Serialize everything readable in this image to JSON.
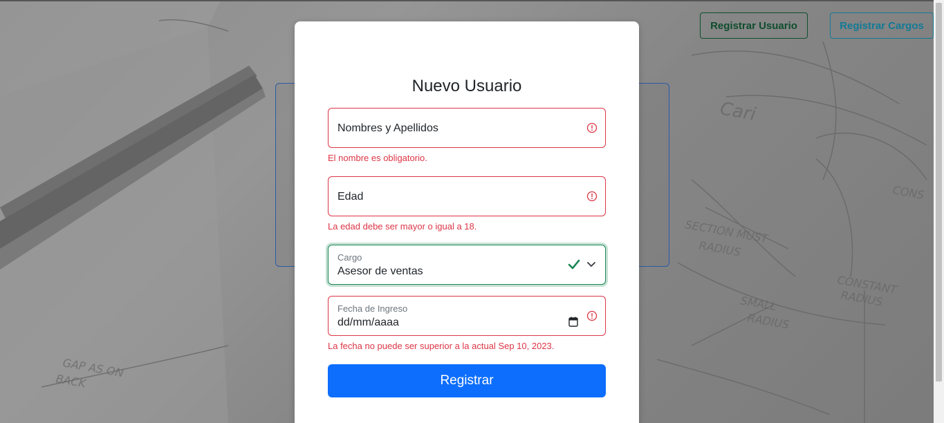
{
  "nav": {
    "register_user": "Registrar Usuario",
    "register_positions": "Registrar Cargos"
  },
  "modal": {
    "title": "Nuevo Usuario",
    "name_field": {
      "placeholder": "Nombres y Apellidos",
      "error": "El nombre es obligatorio."
    },
    "age_field": {
      "placeholder": "Edad",
      "error": "La edad debe ser mayor o igual a 18."
    },
    "position_field": {
      "label": "Cargo",
      "value": "Asesor de ventas"
    },
    "date_field": {
      "label": "Fecha de Ingreso",
      "value": "dd/mm/aaaa",
      "error": "La fecha no puede ser superior a la actual Sep 10, 2023."
    },
    "submit_label": "Registrar"
  },
  "colors": {
    "error": "#dc3545",
    "valid": "#198754",
    "primary": "#0d6efd",
    "nav_user": "#0f4d2e",
    "nav_cargo": "#137a96"
  },
  "icons": [
    "exclamation-circle-icon",
    "check-icon",
    "chevron-down-icon",
    "calendar-icon",
    "pencil-sketch-background"
  ]
}
